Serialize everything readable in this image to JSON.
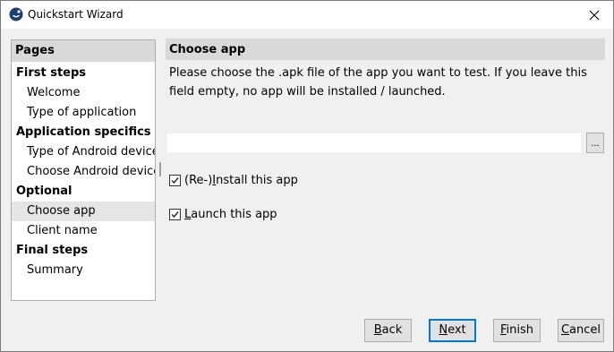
{
  "window": {
    "title": "Quickstart Wizard",
    "icon": "app-logo-icon",
    "close_icon": "close-icon"
  },
  "sidebar": {
    "header": "Pages",
    "selected": "Choose app",
    "groups": [
      {
        "label": "First steps",
        "items": [
          "Welcome",
          "Type of application"
        ]
      },
      {
        "label": "Application specifics",
        "items": [
          "Type of Android device",
          "Choose Android device"
        ]
      },
      {
        "label": "Optional",
        "items": [
          "Choose app",
          "Client name"
        ]
      },
      {
        "label": "Final steps",
        "items": [
          "Summary"
        ]
      }
    ]
  },
  "content": {
    "title": "Choose app",
    "description": "Please choose the .apk file of the app you want to test. If you leave this field empty, no app will be installed / launched.",
    "file_input": {
      "value": "",
      "placeholder": ""
    },
    "browse_label": "...",
    "options": [
      {
        "label_before": "(Re-)",
        "mnemonic": "I",
        "label_after": "nstall this app",
        "checked": true
      },
      {
        "label_before": "",
        "mnemonic": "L",
        "label_after": "aunch this app",
        "checked": true
      }
    ]
  },
  "buttons": {
    "back": {
      "mnemonic": "B",
      "rest": "ack"
    },
    "next": {
      "mnemonic": "N",
      "rest": "ext"
    },
    "finish": {
      "mnemonic": "F",
      "rest": "inish"
    },
    "cancel": {
      "mnemonic": "C",
      "rest": "ancel"
    }
  },
  "colors": {
    "accent": "#0078d7",
    "header_bg": "#d9d9d9",
    "window_bg": "#f0f0f0"
  }
}
